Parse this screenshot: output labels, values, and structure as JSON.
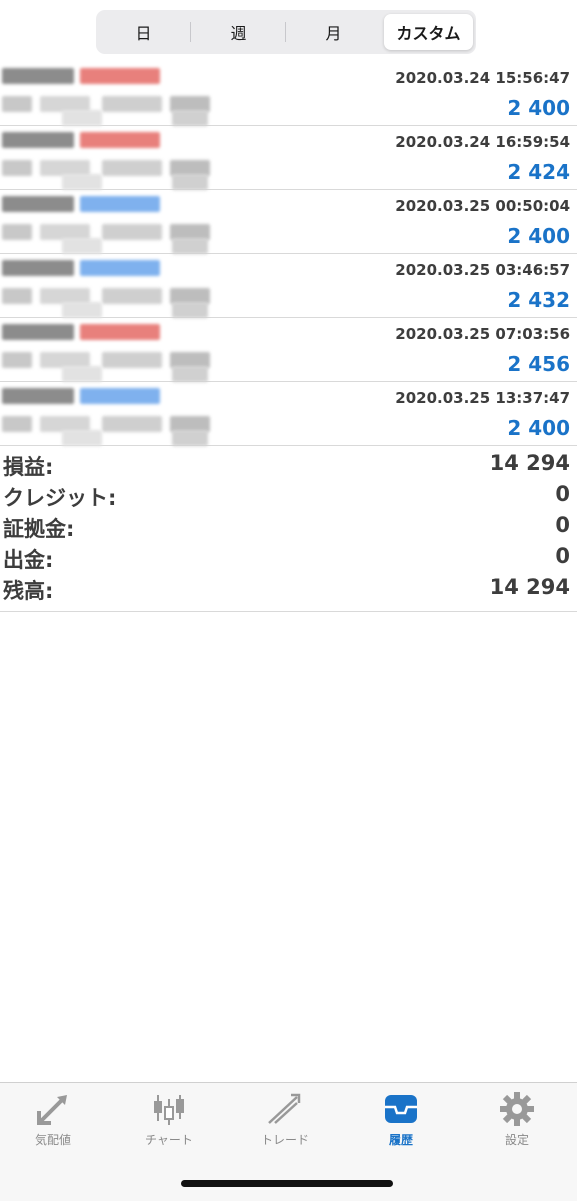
{
  "periods": [
    "日",
    "週",
    "月",
    "カスタム"
  ],
  "active_period": "カスタム",
  "deals": [
    {
      "time": "2020.03.24 15:56:47",
      "profit": "2 400",
      "side": "sell"
    },
    {
      "time": "2020.03.24 16:59:54",
      "profit": "2 424",
      "side": "sell"
    },
    {
      "time": "2020.03.25 00:50:04",
      "profit": "2 400",
      "side": "buy"
    },
    {
      "time": "2020.03.25 03:46:57",
      "profit": "2 432",
      "side": "buy"
    },
    {
      "time": "2020.03.25 07:03:56",
      "profit": "2 456",
      "side": "sell"
    },
    {
      "time": "2020.03.25 13:37:47",
      "profit": "2 400",
      "side": "buy"
    }
  ],
  "summary": [
    {
      "label": "損益:",
      "value": "14 294"
    },
    {
      "label": "クレジット:",
      "value": "0"
    },
    {
      "label": "証拠金:",
      "value": "0"
    },
    {
      "label": "出金:",
      "value": "0"
    },
    {
      "label": "残高:",
      "value": "14 294"
    }
  ],
  "tabs": [
    {
      "label": "気配値",
      "icon": "quotes-icon",
      "active": false
    },
    {
      "label": "チャート",
      "icon": "chart-icon",
      "active": false
    },
    {
      "label": "トレード",
      "icon": "trade-icon",
      "active": false
    },
    {
      "label": "履歴",
      "icon": "history-icon",
      "active": true
    },
    {
      "label": "設定",
      "icon": "gear-icon",
      "active": false
    }
  ],
  "colors": {
    "accent": "#1a73c8",
    "sell_tag": "#e8807c",
    "buy_tag": "#7fb1ee",
    "text": "#3d3d3d"
  }
}
